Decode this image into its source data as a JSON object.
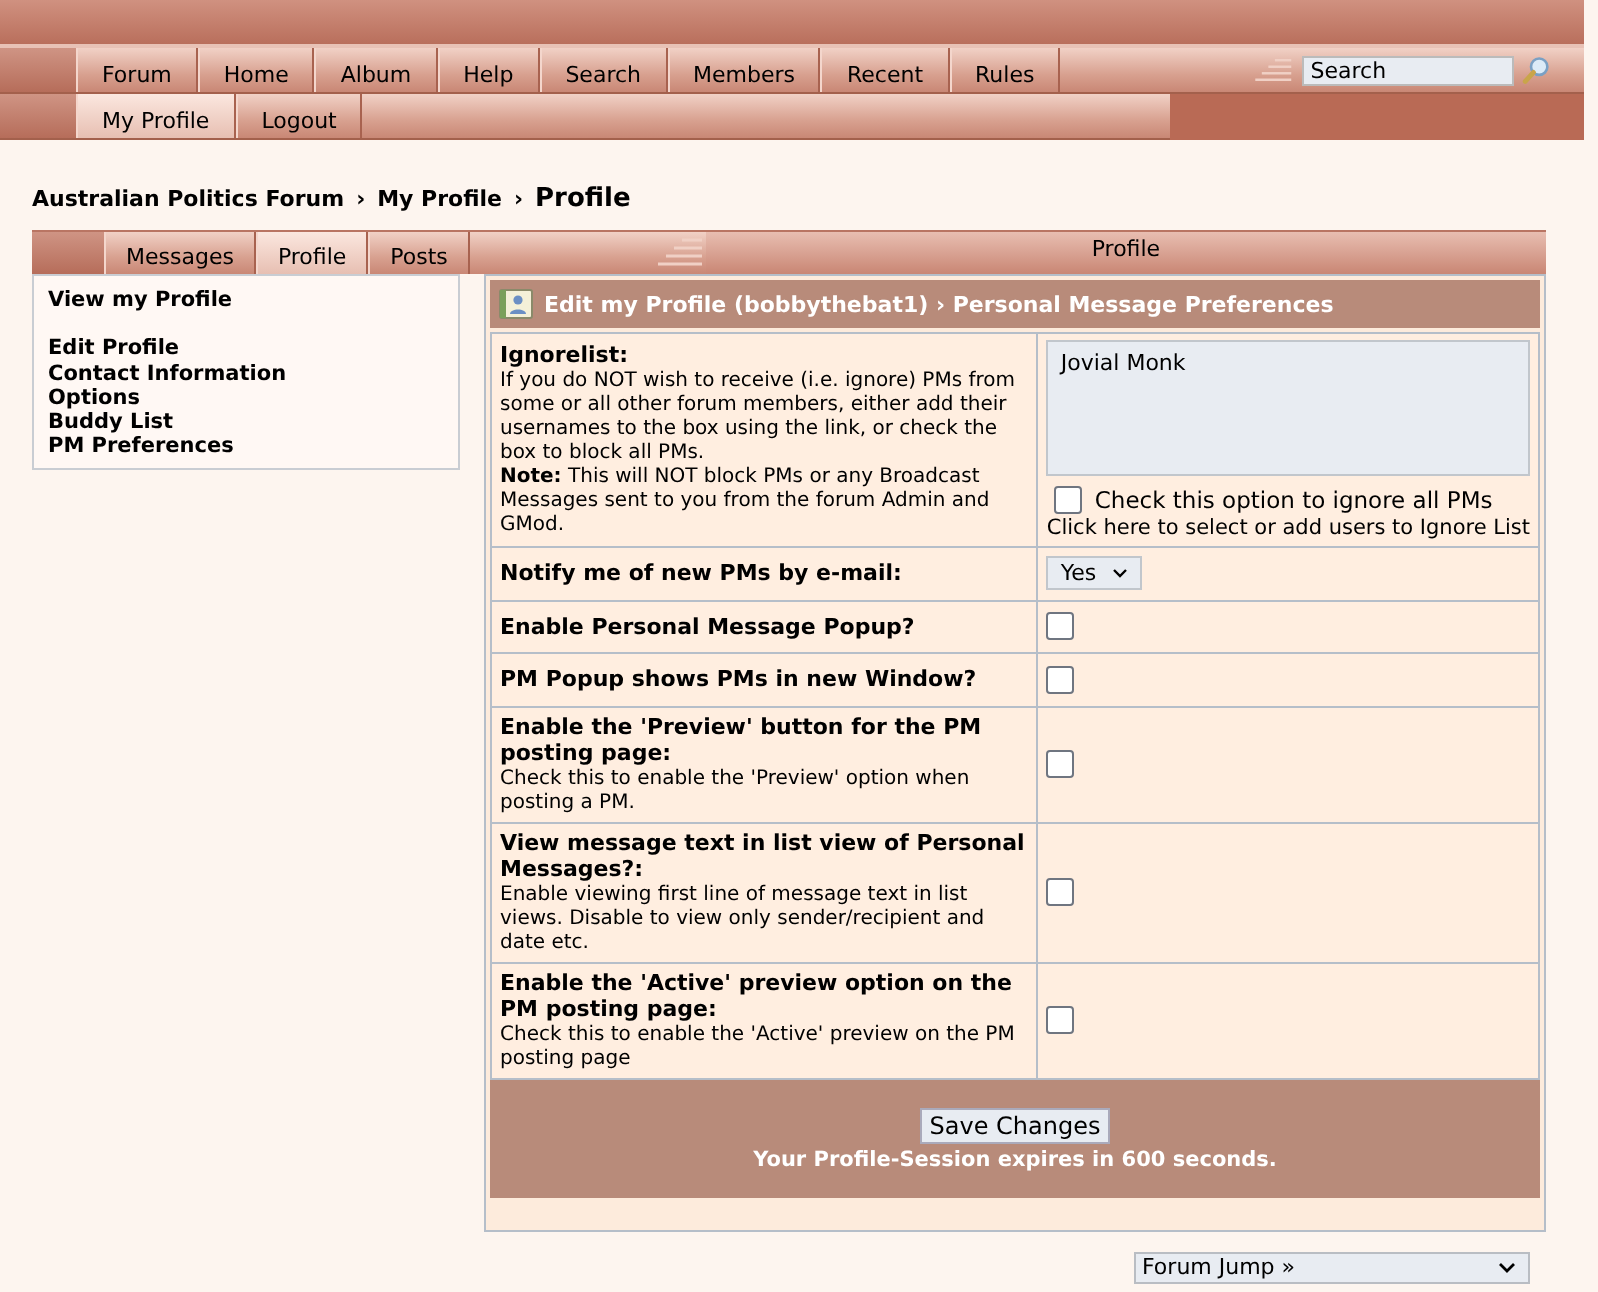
{
  "nav": {
    "items": [
      {
        "label": "Forum"
      },
      {
        "label": "Home"
      },
      {
        "label": "Album"
      },
      {
        "label": "Help"
      },
      {
        "label": "Search"
      },
      {
        "label": "Members"
      },
      {
        "label": "Recent"
      },
      {
        "label": "Rules"
      }
    ],
    "search": {
      "placeholder": "Search"
    },
    "subitems": [
      {
        "label": "My Profile",
        "selected": true
      },
      {
        "label": "Logout",
        "selected": false
      }
    ]
  },
  "breadcrumb": {
    "items": [
      "Australian Politics Forum",
      "My Profile",
      "Profile"
    ],
    "separator": "›"
  },
  "tabs": {
    "items": [
      {
        "label": "Messages",
        "selected": false
      },
      {
        "label": "Profile",
        "selected": true
      },
      {
        "label": "Posts",
        "selected": false
      }
    ],
    "title": "Profile"
  },
  "sidebar": {
    "groups": [
      [
        "View my Profile"
      ],
      [
        "Edit Profile",
        "Contact Information",
        "Options",
        "Buddy List",
        "PM Preferences"
      ]
    ]
  },
  "panel": {
    "title": "Edit my Profile (bobbythebat1) › Personal Message Preferences",
    "rows": [
      {
        "kind": "ignorelist",
        "label": "Ignorelist:",
        "description": "If you do NOT wish to receive (i.e. ignore) PMs from some or all other forum members, either add their usernames to the box using the link, or check the box to block all PMs.",
        "note": "**Note:** This will NOT block PMs or any Broadcast Messages sent to you from the forum Admin and GMod.",
        "value": "Jovial Monk",
        "option": "Check this option to ignore all PMs",
        "checked": false,
        "link": "Click here to select or add users to Ignore List"
      },
      {
        "kind": "select",
        "label": "Notify me of new PMs by e-mail:",
        "value": "Yes"
      },
      {
        "kind": "checkbox",
        "label": "Enable Personal Message Popup?",
        "checked": false
      },
      {
        "kind": "checkbox",
        "label": "PM Popup shows PMs in new Window?",
        "checked": false
      },
      {
        "kind": "checkbox",
        "label": "Enable the 'Preview' button for the PM posting page:",
        "description": "Check this to enable the 'Preview' option when posting a PM.",
        "checked": false
      },
      {
        "kind": "checkbox",
        "label": "View message text in list view of Personal Messages?:",
        "description": "Enable viewing first line of message text in list views. Disable to view only sender/recipient and date etc.",
        "checked": false
      },
      {
        "kind": "checkbox",
        "label": "Enable the 'Active' preview option on the PM posting page:",
        "description": "Check this to enable the 'Active' preview on the PM posting page",
        "checked": false
      }
    ],
    "save": "Save Changes",
    "session": "Your Profile-Session expires in 600 seconds."
  },
  "forum_jump": {
    "value": "Forum Jump »"
  }
}
